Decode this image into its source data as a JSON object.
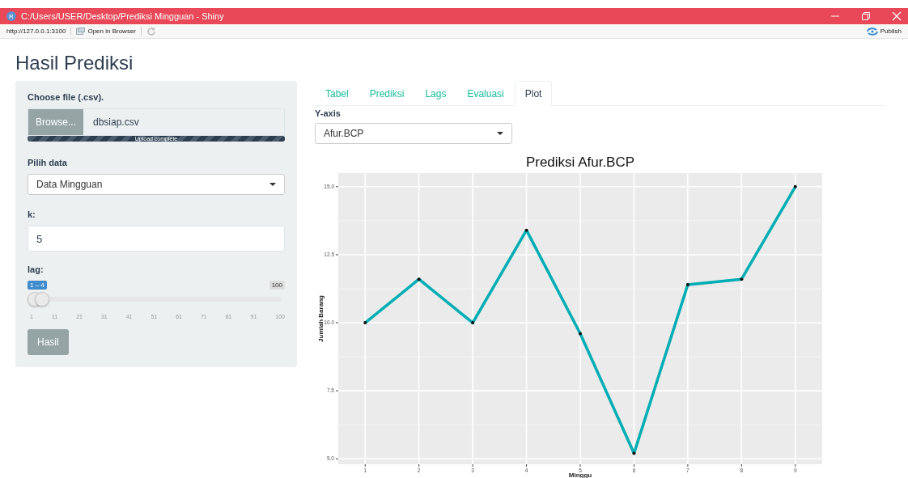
{
  "window": {
    "app_icon": "R",
    "title": "C:/Users/USER/Desktop/Prediksi Mingguan - Shiny"
  },
  "toolbar": {
    "url": "http://127.0.0.1:3100",
    "open_in_browser": "Open in Browser",
    "publish": "Publish"
  },
  "page_title": "Hasil Prediksi",
  "sidebar": {
    "file": {
      "label": "Choose file (.csv).",
      "button": "Browse...",
      "value": "dbsiap.csv",
      "progress": {
        "level": 1,
        "text": "Upload complete"
      }
    },
    "pilih_data": {
      "label": "Pilih data",
      "value": "Data Mingguan"
    },
    "k": {
      "label": "k:",
      "value": "5"
    },
    "lag": {
      "label": "lag:",
      "range_label": "1 – 4",
      "max_label": "100",
      "thumbs": [
        {
          "level": 0
        },
        {
          "level": 0.0303
        }
      ],
      "ticks": [
        "1",
        "11",
        "21",
        "31",
        "41",
        "51",
        "61",
        "71",
        "81",
        "91",
        "100"
      ]
    },
    "button": "Hasil"
  },
  "tabs": [
    {
      "label": "Tabel",
      "selected": false
    },
    {
      "label": "Prediksi",
      "selected": false
    },
    {
      "label": "Lags",
      "selected": false
    },
    {
      "label": "Evaluasi",
      "selected": false
    },
    {
      "label": "Plot",
      "selected": true
    }
  ],
  "yaxis_select": {
    "label": "Y-axis",
    "value": "Afur.BCP"
  },
  "plot": {
    "chart_data": {
      "type": "line",
      "title": "Prediksi Afur.BCP",
      "xlabel": "Minggu",
      "ylabel": "Jumlah Barang",
      "x": [
        1,
        2,
        3,
        4,
        5,
        6,
        7,
        8,
        9
      ],
      "grid": true,
      "series": [
        {
          "color": "#00adb5",
          "values": [
            10.0,
            11.6,
            10.0,
            13.4,
            9.6,
            5.2,
            11.4,
            11.6,
            15.0
          ]
        }
      ],
      "xlim": [
        0.5,
        9.5
      ],
      "ylim": [
        4.8,
        15.5
      ],
      "xticks": [
        1,
        2,
        3,
        4,
        5,
        6,
        7,
        8,
        9
      ],
      "yticks": [
        {
          "value": 5,
          "label": "5.0"
        },
        {
          "value": 7.5,
          "label": "7.5"
        },
        {
          "value": 10,
          "label": "10.0"
        },
        {
          "value": 12.5,
          "label": "12.5"
        },
        {
          "value": 15,
          "label": "15.0"
        }
      ]
    }
  }
}
